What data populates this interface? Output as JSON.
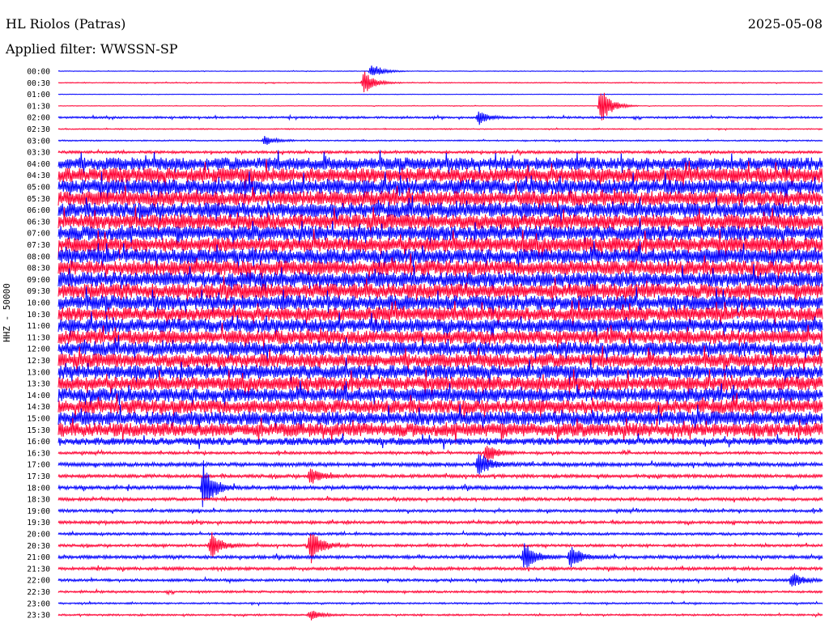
{
  "header": {
    "station": "HL Riolos (Patras)",
    "date": "2025-05-08",
    "filter": "Applied filter: WWSSN-SP"
  },
  "colors": {
    "blue": "#0000ff",
    "red": "#ff0033",
    "label": "#000000"
  },
  "chart_data": {
    "type": "line",
    "title": "HL Riolos (Patras)",
    "subtitle": "Applied filter: WWSSN-SP",
    "ylabel": "HHZ - 50000",
    "xlabel": "",
    "grid": false,
    "series_colors_alternate": [
      "blue",
      "red"
    ],
    "categories": [
      "00:00",
      "00:30",
      "01:00",
      "01:30",
      "02:00",
      "02:30",
      "03:00",
      "03:30",
      "04:00",
      "04:30",
      "05:00",
      "05:30",
      "06:00",
      "06:30",
      "07:00",
      "07:30",
      "08:00",
      "08:30",
      "09:00",
      "09:30",
      "10:00",
      "10:30",
      "11:00",
      "11:30",
      "12:00",
      "12:30",
      "13:00",
      "13:30",
      "14:00",
      "14:30",
      "15:00",
      "15:30",
      "16:00",
      "16:30",
      "17:00",
      "17:30",
      "18:00",
      "18:30",
      "19:00",
      "19:30",
      "20:00",
      "20:30",
      "21:00",
      "21:30",
      "22:00",
      "22:30",
      "23:00",
      "23:30"
    ],
    "noise_level": [
      0.3,
      0.4,
      0.25,
      0.25,
      0.9,
      0.5,
      0.6,
      1.2,
      6,
      7,
      7,
      7,
      7,
      7,
      7,
      7,
      7,
      7,
      7,
      7,
      7,
      6.5,
      6.5,
      6.5,
      6.5,
      6.5,
      6.5,
      6.5,
      6.5,
      6.5,
      6.5,
      6.5,
      3.5,
      1.2,
      1.8,
      1.5,
      1.6,
      1.4,
      1.3,
      1.3,
      1.2,
      1.2,
      1.5,
      1.4,
      1.2,
      1.0,
      0.8,
      0.8
    ],
    "events": [
      {
        "trace": "00:00",
        "position": 0.41,
        "amplitude": 10
      },
      {
        "trace": "00:30",
        "position": 0.4,
        "amplitude": 14
      },
      {
        "trace": "01:30",
        "position": 0.71,
        "amplitude": 25
      },
      {
        "trace": "02:00",
        "position": 0.55,
        "amplitude": 8
      },
      {
        "trace": "03:00",
        "position": 0.27,
        "amplitude": 6
      },
      {
        "trace": "16:30",
        "position": 0.56,
        "amplitude": 12
      },
      {
        "trace": "17:00",
        "position": 0.55,
        "amplitude": 15
      },
      {
        "trace": "17:30",
        "position": 0.33,
        "amplitude": 10
      },
      {
        "trace": "18:00",
        "position": 0.19,
        "amplitude": 30
      },
      {
        "trace": "20:30",
        "position": 0.2,
        "amplitude": 16
      },
      {
        "trace": "20:30",
        "position": 0.33,
        "amplitude": 22
      },
      {
        "trace": "21:00",
        "position": 0.61,
        "amplitude": 18
      },
      {
        "trace": "21:00",
        "position": 0.67,
        "amplitude": 14
      },
      {
        "trace": "22:00",
        "position": 0.96,
        "amplitude": 10
      },
      {
        "trace": "23:30",
        "position": 0.33,
        "amplitude": 6
      }
    ]
  }
}
